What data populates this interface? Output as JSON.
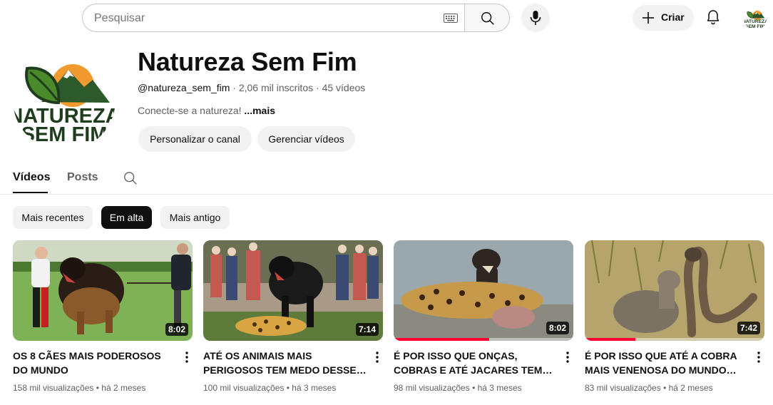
{
  "search": {
    "placeholder": "Pesquisar",
    "value": ""
  },
  "header": {
    "create_label": "Criar"
  },
  "channel": {
    "name": "Natureza Sem Fim",
    "logo_text_line1": "NATUREZA",
    "logo_text_line2": "SEM FIM",
    "handle": "@natureza_sem_fim",
    "subscribers": "2,06 mil inscritos",
    "video_count": "45 vídeos",
    "separator": "·",
    "description": "Conecte-se a natureza!",
    "more_label": "...mais",
    "buttons": {
      "customize": "Personalizar o canal",
      "manage": "Gerenciar vídeos"
    }
  },
  "tabs": [
    {
      "label": "Vídeos",
      "active": true
    },
    {
      "label": "Posts",
      "active": false
    }
  ],
  "chips": [
    {
      "label": "Mais recentes",
      "active": false
    },
    {
      "label": "Em alta",
      "active": true
    },
    {
      "label": "Mais antigo",
      "active": false
    }
  ],
  "videos": [
    {
      "title": "OS 8 CÃES MAIS PODEROSOS DO MUNDO",
      "duration": "8:02",
      "views": "158 mil visualizações",
      "age": "há 2 meses",
      "watched_fraction": 0
    },
    {
      "title": "ATÉ OS ANIMAIS MAIS PERIGOSOS TEM MEDO DESSES CÃES",
      "duration": "7:14",
      "views": "100 mil visualizações",
      "age": "há 3 meses",
      "watched_fraction": 0
    },
    {
      "title": "É POR ISSO QUE ONÇAS, COBRAS E ATÉ JACARES TEM MEDO DESTA...",
      "duration": "8:02",
      "views": "98 mil visualizações",
      "age": "há 3 meses",
      "watched_fraction": 0.53
    },
    {
      "title": "É POR ISSO QUE ATÉ A COBRA MAIS VENENOSA DO MUNDO TEM...",
      "duration": "7:42",
      "views": "83 mil visualizações",
      "age": "há 2 meses",
      "watched_fraction": 0.28
    }
  ],
  "colors": {
    "progress": "#ff0033",
    "logo_green": "#2d5a2b",
    "logo_orange": "#f29a2e"
  }
}
